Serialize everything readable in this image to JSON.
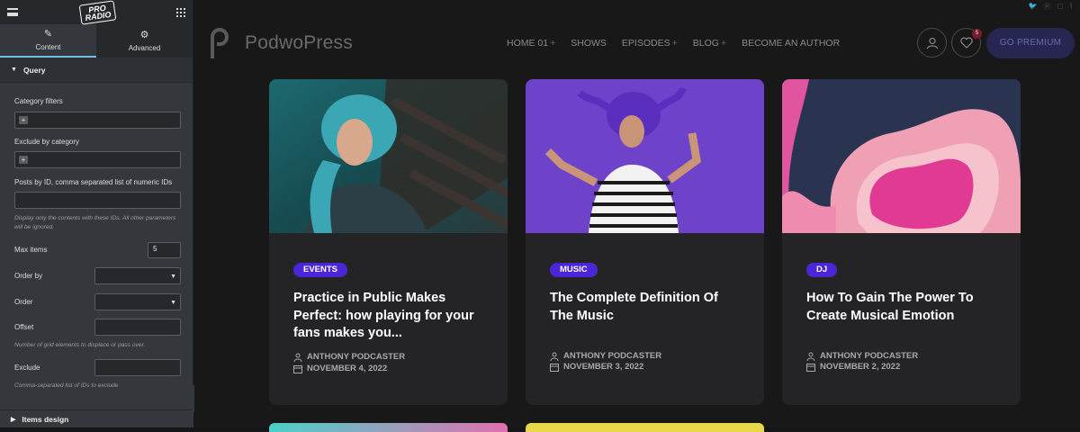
{
  "panel": {
    "tabs": [
      {
        "label": "Content",
        "icon": "pencil-icon"
      },
      {
        "label": "Advanced",
        "icon": "gear-icon"
      }
    ],
    "section_query": "Query",
    "fields": {
      "category_filters": "Category filters",
      "exclude_by_category": "Exclude by category",
      "posts_by_id": "Posts by ID, comma separated list of numeric IDs",
      "posts_by_id_help": "Display only the contents with these IDs. All other parameters will be ignored.",
      "max_items": "Max items",
      "max_items_value": "5",
      "order_by": "Order by",
      "order": "Order",
      "offset": "Offset",
      "offset_help": "Number of grid elements to displace or pass over.",
      "exclude": "Exclude",
      "exclude_help": "Comma-separated list of IDs to exclude"
    },
    "section_items_design": "Items design",
    "logo_text": "PRO RADIO"
  },
  "site": {
    "brand": "PodwoPress",
    "nav": [
      {
        "label": "HOME 01",
        "plus": "+"
      },
      {
        "label": "SHOWS",
        "plus": ""
      },
      {
        "label": "EPISODES",
        "plus": "+"
      },
      {
        "label": "BLOG",
        "plus": "+"
      },
      {
        "label": "BECOME AN AUTHOR",
        "plus": ""
      }
    ],
    "favorites_count": "5",
    "go_premium": "GO PREMIUM",
    "social_icons": [
      "twitter-icon",
      "pinterest-icon",
      "instagram-icon",
      "rss-icon"
    ],
    "cards": [
      {
        "category": "EVENTS",
        "title": "Practice in Public Makes Perfect: how playing for your fans makes you...",
        "author": "ANTHONY PODCASTER",
        "date": "NOVEMBER 4, 2022"
      },
      {
        "category": "MUSIC",
        "title": "The Complete Definition Of The Music",
        "author": "ANTHONY PODCASTER",
        "date": "NOVEMBER 3, 2022"
      },
      {
        "category": "DJ",
        "title": "How To Gain The Power To Create Musical Emotion",
        "author": "ANTHONY PODCASTER",
        "date": "NOVEMBER 2, 2022"
      }
    ],
    "colors": {
      "accent": "#4b26d8",
      "card_bg": "#242426",
      "panel_accent": "#6ec1e4"
    }
  }
}
